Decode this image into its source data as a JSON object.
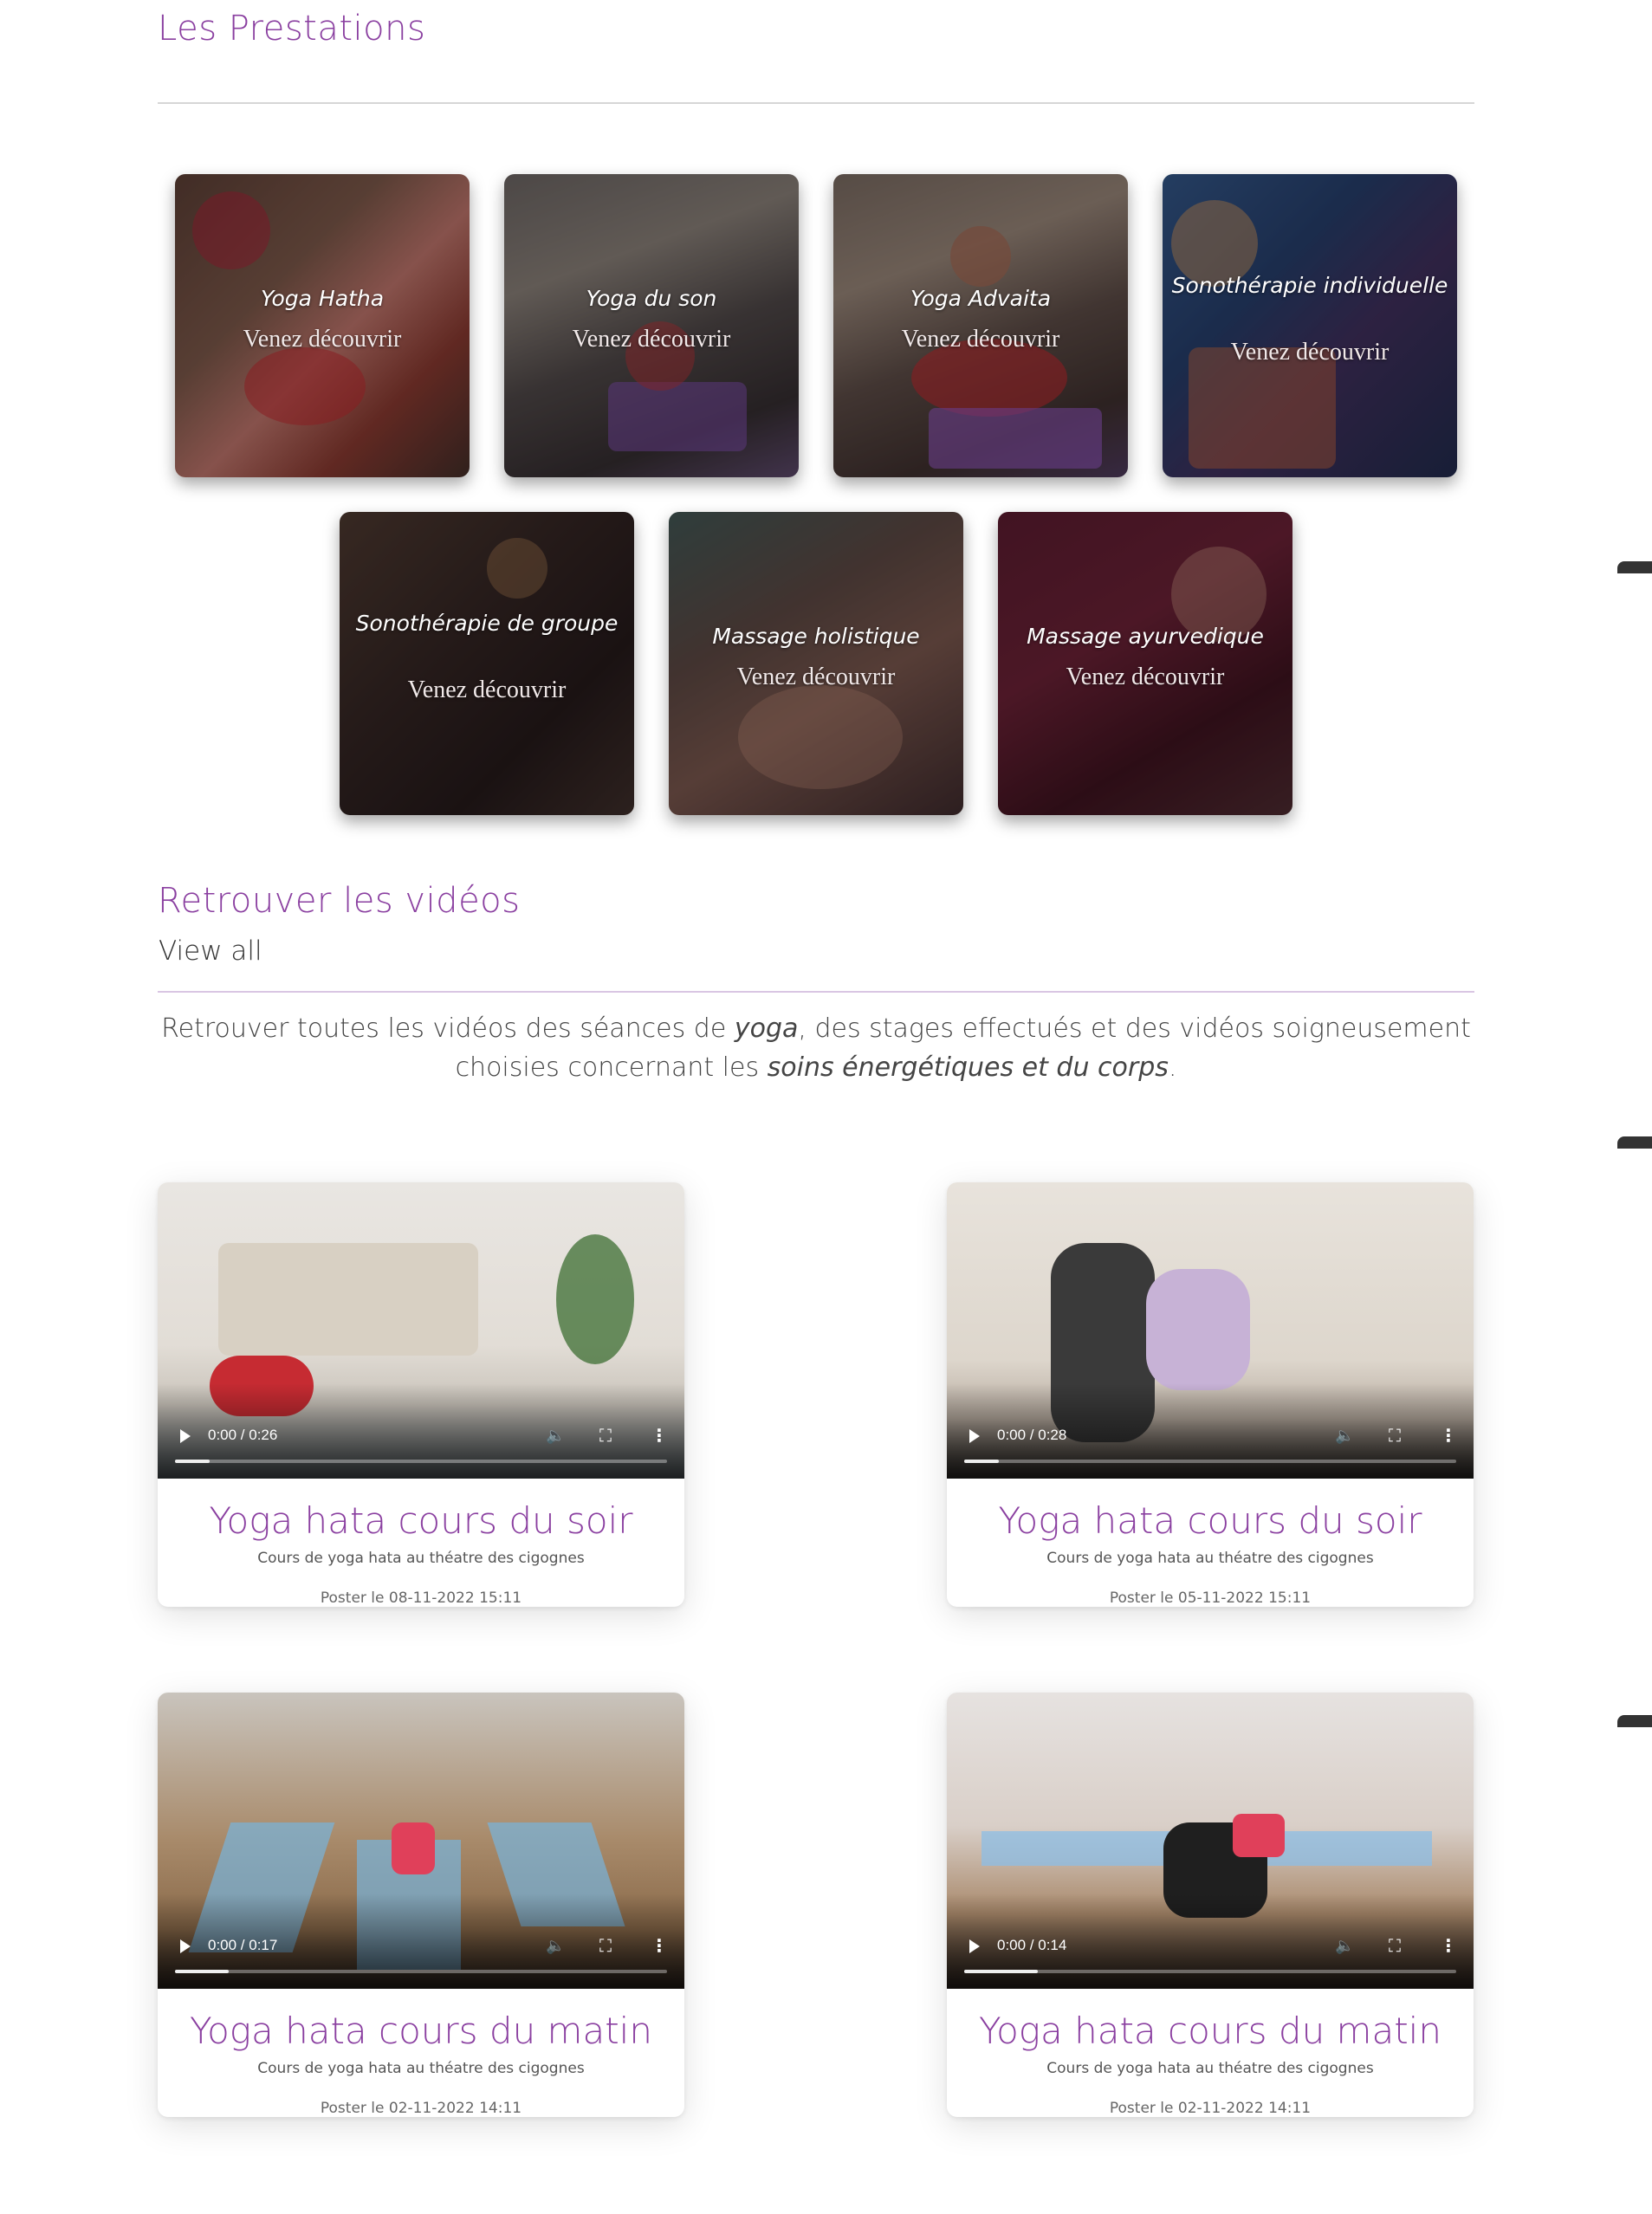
{
  "prestations": {
    "title": "Les Prestations",
    "items": [
      {
        "name": "Yoga Hatha",
        "cta": "Venez découvrir"
      },
      {
        "name": "Yoga du son",
        "cta": "Venez découvrir"
      },
      {
        "name": "Yoga Advaita",
        "cta": "Venez découvrir"
      },
      {
        "name": "Sonothérapie individuelle",
        "cta": "Venez découvrir"
      },
      {
        "name": "Sonothérapie de groupe",
        "cta": "Venez découvrir"
      },
      {
        "name": "Massage holistique",
        "cta": "Venez découvrir"
      },
      {
        "name": "Massage ayurvedique",
        "cta": "Venez découvrir"
      }
    ]
  },
  "videos": {
    "title": "Retrouver les vidéos",
    "view_all": "View all",
    "description": {
      "part1": "Retrouver toutes les vidéos des séances de ",
      "em1": "yoga",
      "part2": ", des stages effectués et des vidéos soigneusement choisies concernant les ",
      "em2": "soins énergétiques et du corps",
      "part3": "."
    },
    "items": [
      {
        "title": "Yoga hata cours du soir",
        "description": "Cours de yoga hata au théatre des cigognes",
        "date": "Poster le 08-11-2022 15:11",
        "time": "0:00 / 0:26",
        "progress": 0.07
      },
      {
        "title": "Yoga hata cours du soir",
        "description": "Cours de yoga hata au théatre des cigognes",
        "date": "Poster le 05-11-2022 15:11",
        "time": "0:00 / 0:28",
        "progress": 0.07
      },
      {
        "title": "Yoga hata cours du matin",
        "description": "Cours de yoga hata au théatre des cigognes",
        "date": "Poster le 02-11-2022 14:11",
        "time": "0:00 / 0:17",
        "progress": 0.11
      },
      {
        "title": "Yoga hata cours du matin",
        "description": "Cours de yoga hata au théatre des cigognes",
        "date": "Poster le 02-11-2022 14:11",
        "time": "0:00 / 0:14",
        "progress": 0.15
      }
    ]
  },
  "colors": {
    "accent": "#8a3fa0"
  }
}
